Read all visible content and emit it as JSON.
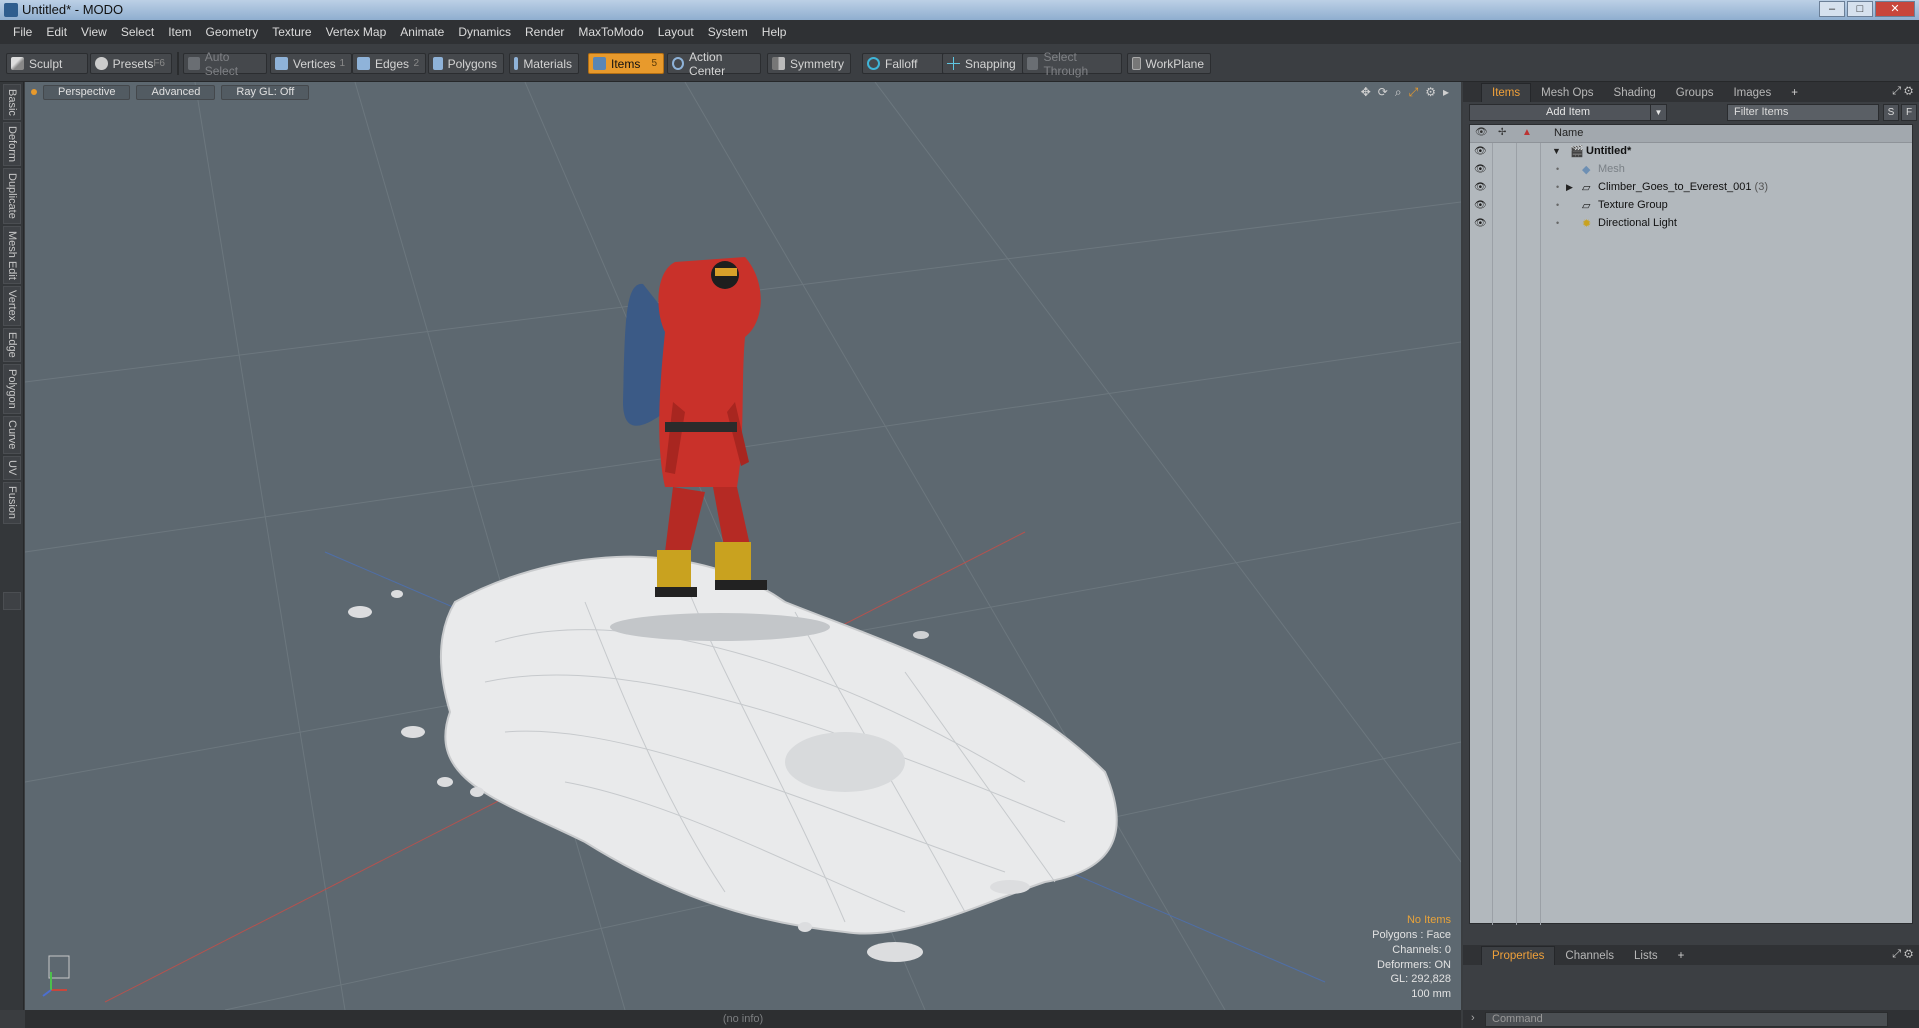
{
  "window": {
    "title": "Untitled* - MODO",
    "buttons": [
      "–",
      "□",
      "✕"
    ]
  },
  "menu": [
    "File",
    "Edit",
    "View",
    "Select",
    "Item",
    "Geometry",
    "Texture",
    "Vertex Map",
    "Animate",
    "Dynamics",
    "Render",
    "MaxToModo",
    "Layout",
    "System",
    "Help"
  ],
  "toolbar": {
    "sculpt": "Sculpt",
    "presets": "Presets",
    "presets_key": "F6",
    "auto_select": "Auto Select",
    "vertices": "Vertices",
    "vertices_key": "1",
    "edges": "Edges",
    "edges_key": "2",
    "polygons": "Polygons",
    "materials": "Materials",
    "items": "Items",
    "items_key": "5",
    "action_center": "Action Center",
    "symmetry": "Symmetry",
    "falloff": "Falloff",
    "snapping": "Snapping",
    "select_through": "Select Through",
    "workplane": "WorkPlane"
  },
  "left_tabs": [
    "Basic",
    "Deform",
    "Duplicate",
    "Mesh Edit",
    "Vertex",
    "Edge",
    "Polygon",
    "Curve",
    "UV",
    "Fusion"
  ],
  "viewport": {
    "view": "Perspective",
    "shading": "Advanced",
    "raygl": "Ray GL: Off",
    "info": "(no info)",
    "stats": {
      "selection": "No Items",
      "polygons": "Polygons : Face",
      "channels": "Channels: 0",
      "deformers": "Deformers: ON",
      "gl": "GL: 292,828",
      "scale": "100 mm"
    }
  },
  "right_panel": {
    "tabs": [
      "Items",
      "Mesh Ops",
      "Shading",
      "Groups",
      "Images"
    ],
    "add_item": "Add Item",
    "filter_placeholder": "Filter Items",
    "s_btn": "S",
    "f_btn": "F",
    "name_col": "Name",
    "tree": [
      {
        "label": "Untitled*",
        "count": ""
      },
      {
        "label": "Mesh",
        "count": ""
      },
      {
        "label": "Climber_Goes_to_Everest_001",
        "count": "(3)"
      },
      {
        "label": "Texture Group",
        "count": ""
      },
      {
        "label": "Directional Light",
        "count": ""
      }
    ],
    "bottom_tabs": [
      "Properties",
      "Channels",
      "Lists"
    ],
    "command_placeholder": "Command"
  },
  "colors": {
    "accent": "#e89a2c",
    "viewport_bg": "#5d6870",
    "tree_bg": "#b2b8bd"
  }
}
